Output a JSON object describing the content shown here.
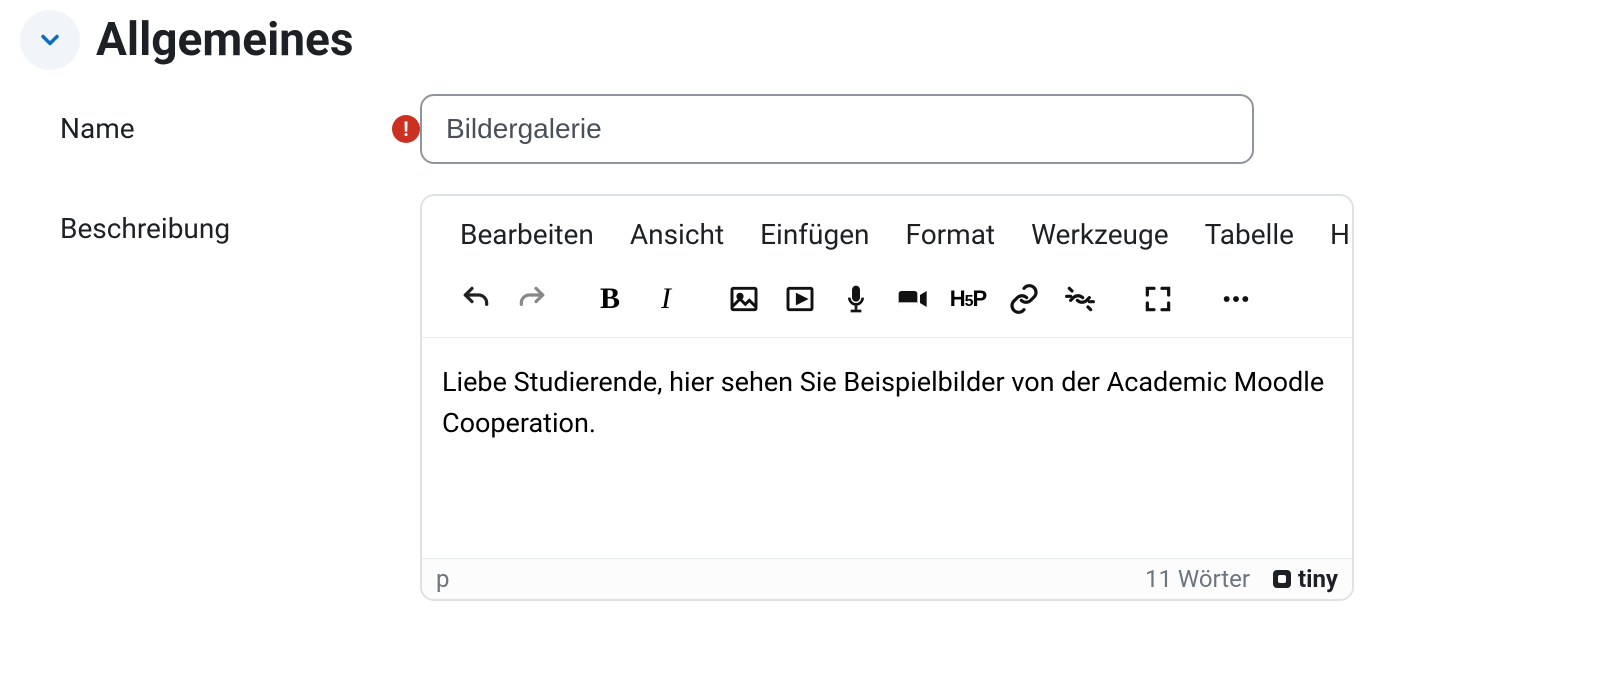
{
  "section": {
    "title": "Allgemeines"
  },
  "fields": {
    "name": {
      "label": "Name",
      "required_glyph": "!",
      "value": "Bildergalerie"
    },
    "description": {
      "label": "Beschreibung"
    }
  },
  "editor": {
    "menubar": {
      "edit": "Bearbeiten",
      "view": "Ansicht",
      "insert": "Einfügen",
      "format": "Format",
      "tools": "Werkzeuge",
      "table": "Tabelle",
      "help": "Hilfe"
    },
    "toolbar": {
      "bold": "B",
      "italic": "I",
      "h5p": "H5P"
    },
    "content": "Liebe Studierende, hier sehen Sie Beispielbilder von der Academic Moodle Cooperation.",
    "statusbar": {
      "path": "p",
      "wordcount": "11 Wörter",
      "brand": "tiny"
    }
  }
}
